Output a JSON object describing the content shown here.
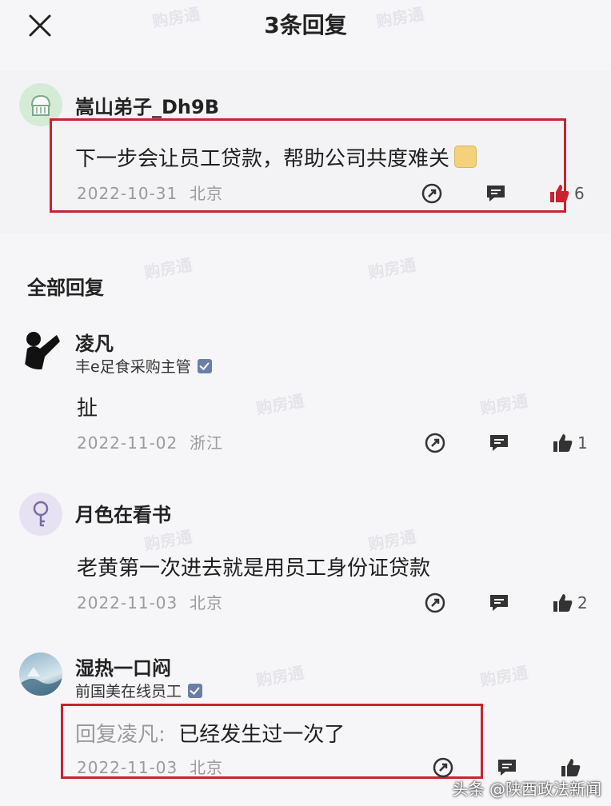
{
  "header": {
    "title": "3条回复"
  },
  "top_comment": {
    "username": "嵩山弟子_Dh9B",
    "content": "下一步会让员工贷款，帮助公司共度难关",
    "date": "2022-10-31",
    "location": "北京",
    "likes": "6"
  },
  "section_title": "全部回复",
  "replies": [
    {
      "username": "凌凡",
      "subtitle": "丰e足食采购主管",
      "content": "扯",
      "date": "2022-11-02",
      "location": "浙江",
      "likes": "1"
    },
    {
      "username": "月色在看书",
      "content": "老黄第一次进去就是用员工身份证贷款",
      "date": "2022-11-03",
      "location": "北京",
      "likes": "2"
    },
    {
      "username": "湿热一口闷",
      "subtitle": "前国美在线员工",
      "reply_prefix": "回复凌凡:",
      "content": "已经发生过一次了",
      "date": "2022-11-03",
      "location": "北京"
    }
  ],
  "watermark": "购房通",
  "footer": "头条 @陕西政法新闻",
  "colors": {
    "highlight_border": "#c8232e",
    "like_active": "#c8232e",
    "verified_badge": "#6b7ea8"
  }
}
